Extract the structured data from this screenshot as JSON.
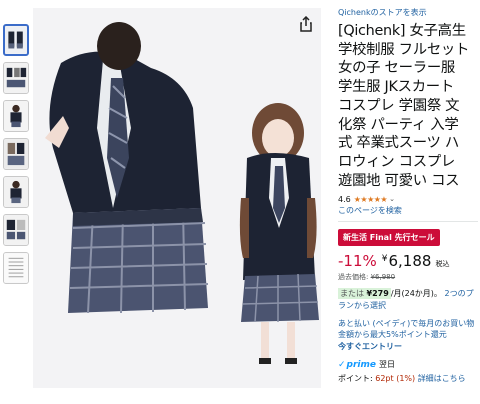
{
  "store_link": "Qichenkのストアを表示",
  "title_lines": [
    "[Qichenk] 女子高生",
    "学校制服 フルセット",
    "女の子 セーラー服",
    "学生服 JKスカート",
    "コスプレ 学園祭 文",
    "化祭 パーティ 入学",
    "式 卒業式スーツ ハ",
    "ロウィン コスプレ",
    "遊園地 可愛い コス"
  ],
  "rating": {
    "value": "4.6",
    "stars": "★★★★★",
    "fill_fraction": 0.92
  },
  "search_link": "このページを検索",
  "deal_badge": "新生活 Final 先行セール",
  "price": {
    "discount": "-11%",
    "currency": "¥",
    "amount": "6,188",
    "tax": "税込",
    "ref_label": "過去価格:",
    "ref_price": "¥6,980"
  },
  "installment": {
    "prefix": "または",
    "amount": "¥279",
    "suffix": "/月(24か月)。",
    "link": "2つのプランから選択"
  },
  "paidy": {
    "text": "あと払い (ペイディ)で毎月のお買い物金額から最大5%ポイント還元",
    "entry": "今すぐエントリー"
  },
  "prime": {
    "word": "prime",
    "delivery": "翌日"
  },
  "points": {
    "label": "ポイント: ",
    "value": "62pt",
    "percent": "(1%)",
    "link": "詳細はこちら"
  },
  "icons": {
    "share": "share-icon"
  },
  "colors": {
    "deal": "#cc0c39",
    "link": "#2162a1",
    "star": "#de7921",
    "prime": "#1399ff"
  }
}
